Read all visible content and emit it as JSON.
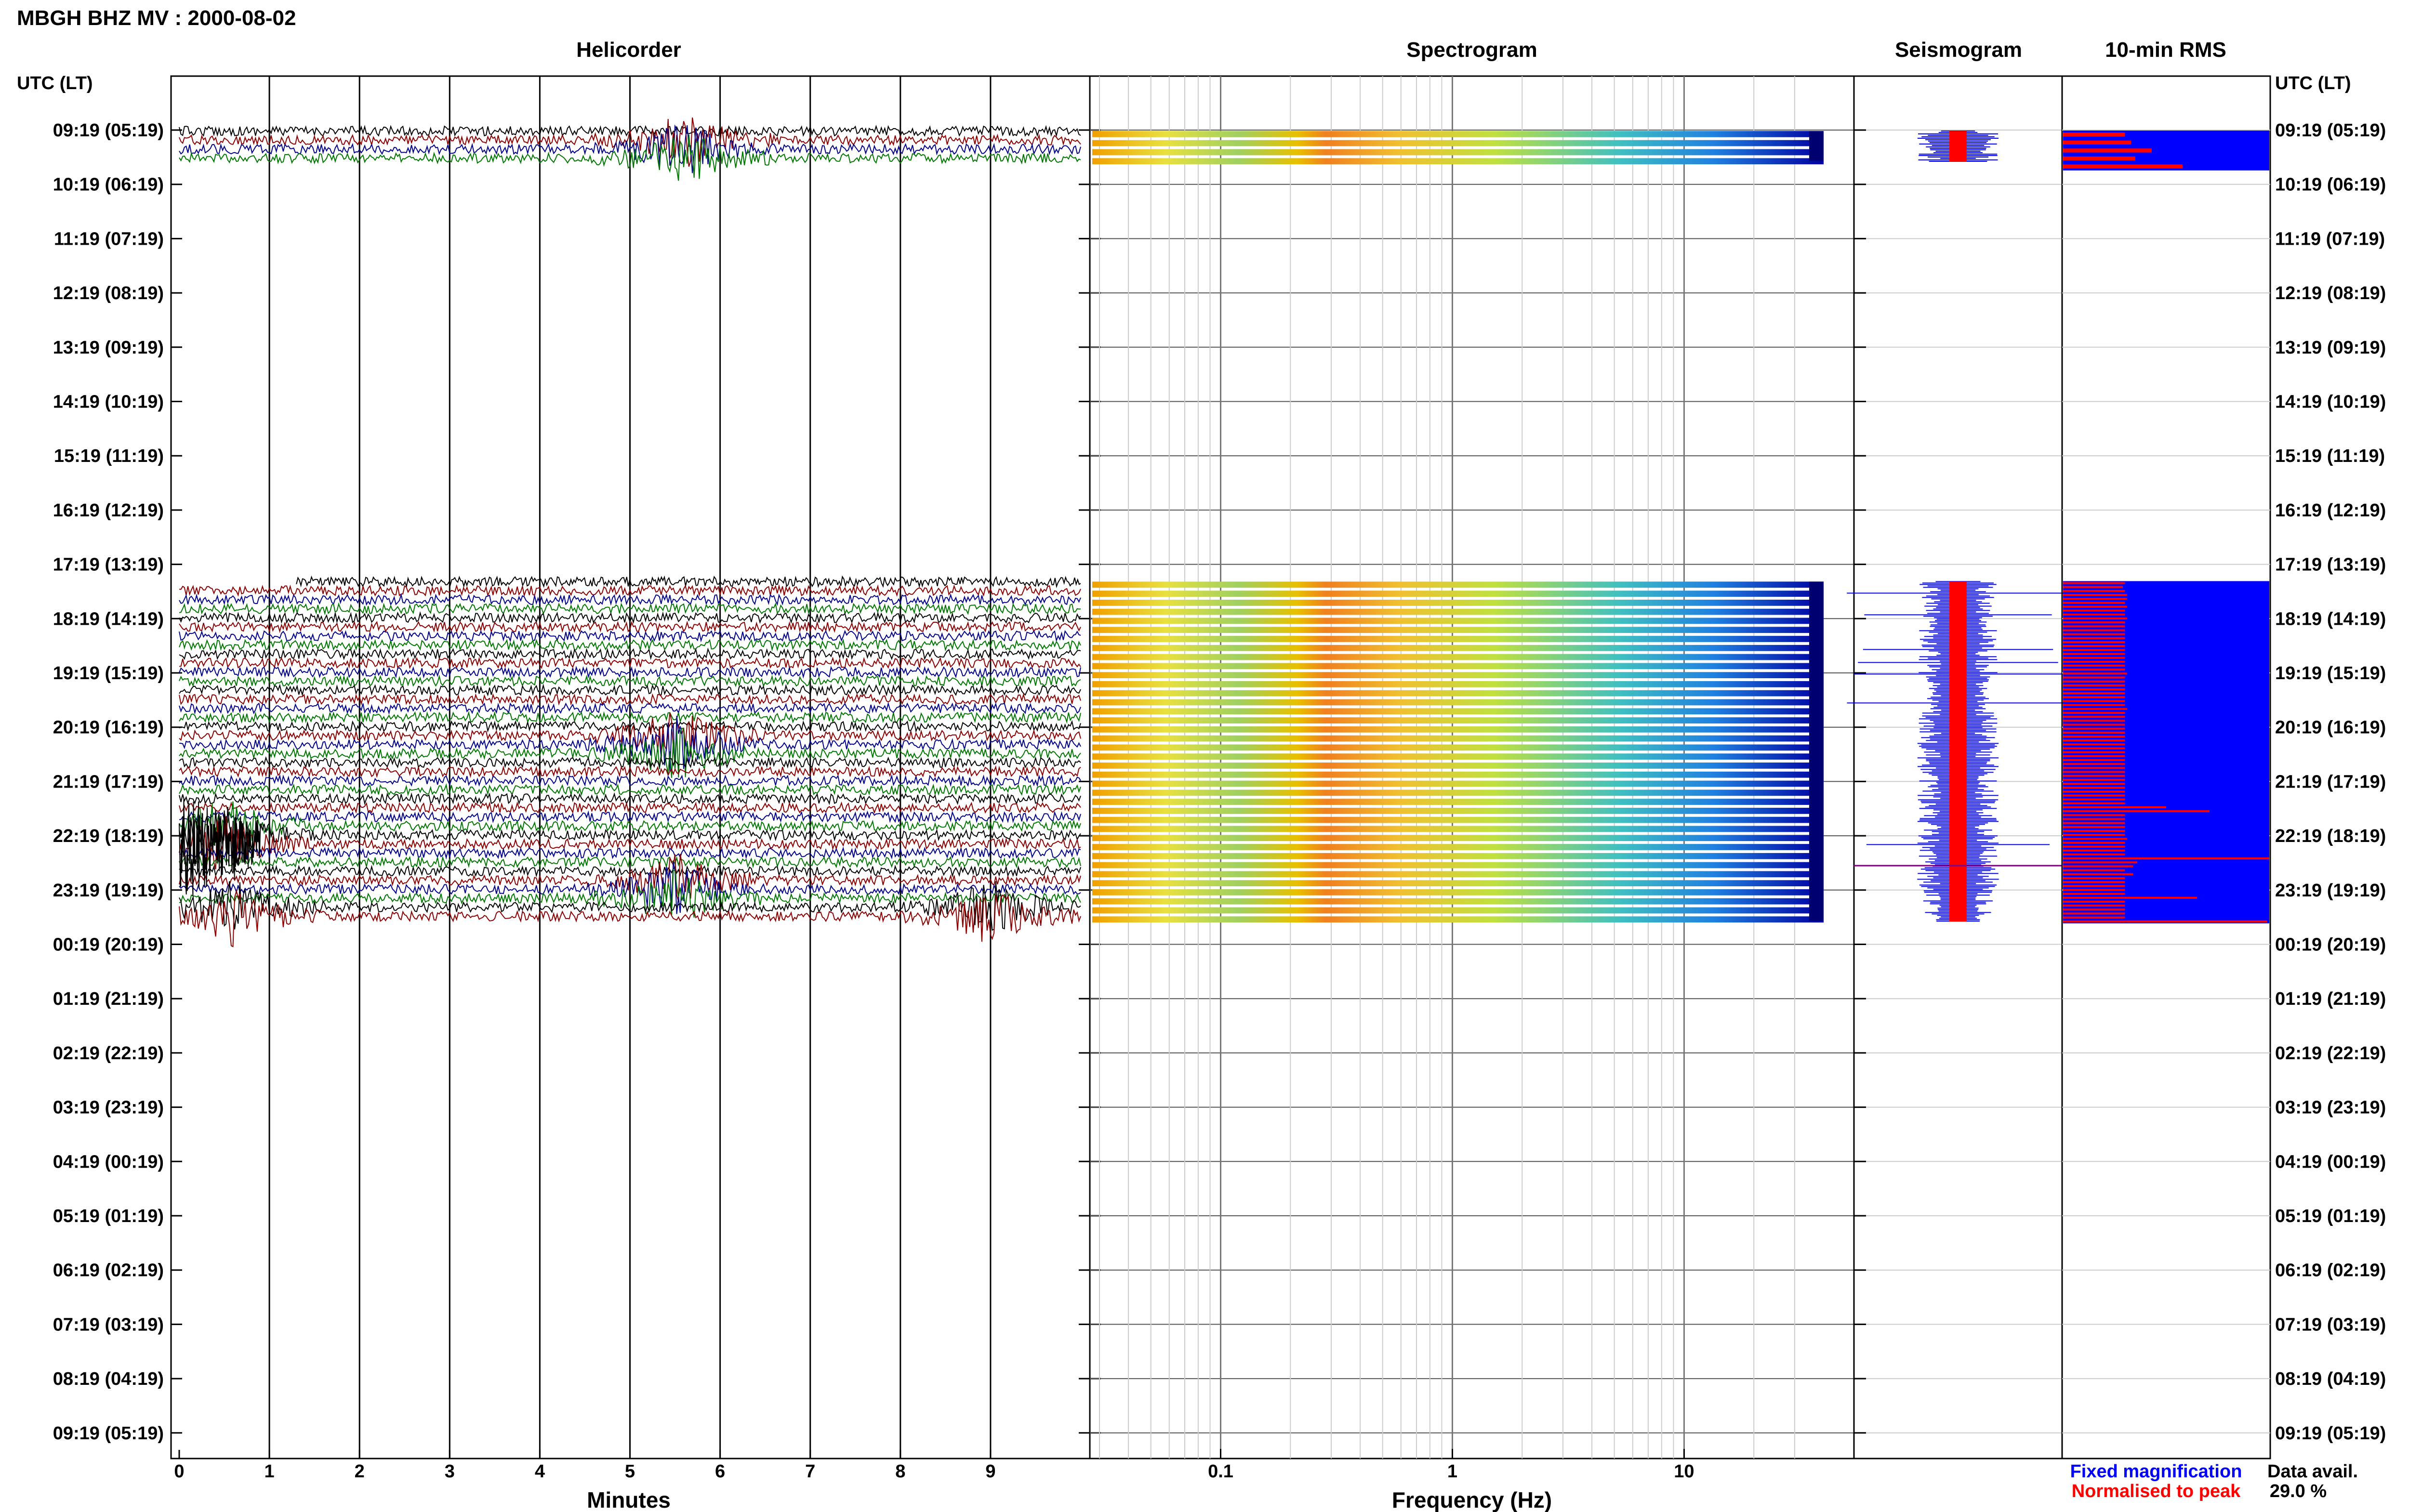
{
  "figure_title": "MBGH BHZ MV : 2000-08-02",
  "panels": {
    "helicorder": "Helicorder",
    "spectrogram": "Spectrogram",
    "seismogram": "Seismogram",
    "rms": "10-min RMS"
  },
  "time_axis_label": "UTC (LT)",
  "time_labels": [
    "09:19 (05:19)",
    "10:19 (06:19)",
    "11:19 (07:19)",
    "12:19 (08:19)",
    "13:19 (09:19)",
    "14:19 (10:19)",
    "15:19 (11:19)",
    "16:19 (12:19)",
    "17:19 (13:19)",
    "18:19 (14:19)",
    "19:19 (15:19)",
    "20:19 (16:19)",
    "21:19 (17:19)",
    "22:19 (18:19)",
    "23:19 (19:19)",
    "00:19 (20:19)",
    "01:19 (21:19)",
    "02:19 (22:19)",
    "03:19 (23:19)",
    "04:19 (00:19)",
    "05:19 (01:19)",
    "06:19 (02:19)",
    "07:19 (03:19)",
    "08:19 (04:19)",
    "09:19 (05:19)"
  ],
  "helicorder_xlabel": "Minutes",
  "helicorder_ticks": [
    "0",
    "1",
    "2",
    "3",
    "4",
    "5",
    "6",
    "7",
    "8",
    "9"
  ],
  "spectrogram_xlabel": "Frequency (Hz)",
  "spectrogram_ticks": [
    "0.1",
    "1",
    "10"
  ],
  "legend": {
    "fixed": "Fixed magnification",
    "normalised": "Normalised to peak",
    "fixed_color": "#0000ff",
    "normalised_color": "#ff0000"
  },
  "data_avail_label": "Data avail.",
  "data_avail_value": "29.0 %",
  "trace_colors": [
    "#000000",
    "#8b0000",
    "#00008b",
    "#007700"
  ],
  "spectrogram_colors": [
    "#f0a000",
    "#ffff40",
    "#00c0c0",
    "#0000a0"
  ],
  "chart_data": [
    {
      "type": "line",
      "title": "Helicorder",
      "xlabel": "Minutes",
      "xlim": [
        0,
        10
      ],
      "ylabel": "UTC (LT)",
      "data_rows_hours": [
        {
          "start_hour": 0,
          "end_hour": 0.6
        },
        {
          "start_hour": 8.3,
          "end_hour": 14.6
        }
      ],
      "events": [
        {
          "hour": 0.3,
          "minute": 5.6,
          "color": "#007700"
        },
        {
          "hour": 11.3,
          "minute": 5.5,
          "color": "#8b0000"
        },
        {
          "hour": 13.0,
          "minute": 0.5,
          "color": "#000000"
        },
        {
          "hour": 14.0,
          "minute": 5.5,
          "color": "#00008b"
        },
        {
          "hour": 14.4,
          "minute": 9.0,
          "color": "#00008b"
        },
        {
          "hour": 14.5,
          "minute": 0.6,
          "color": "#000000"
        }
      ]
    },
    {
      "type": "heatmap",
      "title": "Spectrogram",
      "xlabel": "Frequency (Hz)",
      "x_scale": "log",
      "xlim": [
        0.03,
        40
      ],
      "data_rows_hours": [
        {
          "start_hour": 0,
          "end_hour": 0.6
        },
        {
          "start_hour": 8.3,
          "end_hour": 14.6
        }
      ]
    },
    {
      "type": "bar",
      "title": "Seismogram",
      "data_rows_hours": [
        {
          "start_hour": 0,
          "end_hour": 0.6
        },
        {
          "start_hour": 8.3,
          "end_hour": 14.6
        }
      ]
    },
    {
      "type": "bar",
      "title": "10-min RMS",
      "series": [
        {
          "name": "Fixed magnification",
          "color": "#0000ff"
        },
        {
          "name": "Normalised to peak",
          "color": "#ff0000"
        }
      ],
      "red_bar_fraction_segment1": [
        0.3,
        0.33,
        0.43,
        0.35,
        0.58
      ],
      "red_bar_fraction_segment2": [
        0.3,
        0.29,
        0.3,
        0.31,
        0.31,
        0.3,
        0.31,
        0.3,
        0.3,
        0.31,
        0.3,
        0.3,
        0.3,
        0.3,
        0.3,
        0.3,
        0.3,
        0.3,
        0.3,
        0.3,
        0.3,
        0.3,
        0.3,
        0.31,
        0.3,
        0.3,
        0.3,
        0.3,
        0.3,
        0.3,
        0.3,
        0.3,
        0.31,
        0.3,
        0.3,
        0.3,
        0.3,
        0.3,
        0.3,
        0.3,
        0.3,
        0.3,
        0.3,
        0.3,
        0.3,
        0.3,
        0.3,
        0.3,
        0.3,
        0.3,
        0.3,
        0.3,
        0.3,
        0.3,
        0.3,
        0.3,
        0.3,
        0.5,
        0.71,
        0.3,
        0.3,
        0.3,
        0.3,
        0.3,
        0.3,
        0.31,
        0.3,
        0.3,
        0.3,
        0.3,
        1.0,
        0.36,
        0.34,
        0.3,
        0.34,
        0.3,
        0.3,
        0.3,
        0.3,
        0.3,
        0.65,
        0.3,
        0.3,
        0.3,
        0.3,
        0.3,
        0.99
      ]
    }
  ]
}
